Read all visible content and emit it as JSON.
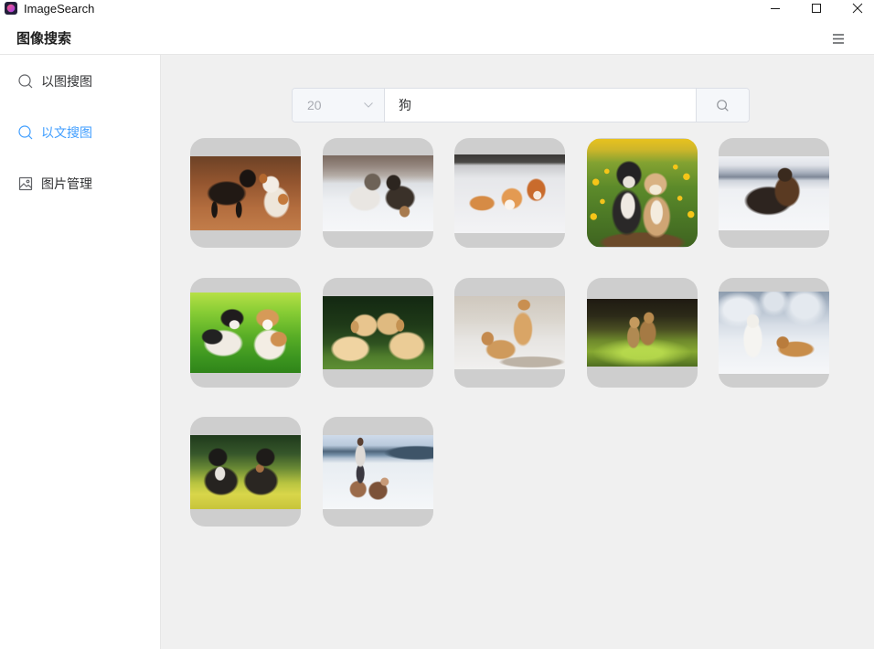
{
  "window": {
    "app_name": "ImageSearch",
    "app_icon": "app-logo-icon",
    "controls": {
      "minimize": "minimize-icon",
      "maximize": "maximize-icon",
      "close": "close-icon"
    }
  },
  "header": {
    "title": "图像搜索",
    "menu_icon": "menu-icon"
  },
  "sidebar": {
    "items": [
      {
        "label": "以图搜图",
        "icon": "search-icon",
        "active": false
      },
      {
        "label": "以文搜图",
        "icon": "search-icon",
        "active": true
      },
      {
        "label": "图片管理",
        "icon": "image-icon",
        "active": false
      }
    ]
  },
  "search": {
    "limit_value": "20",
    "limit_icon": "chevron-down-icon",
    "query": "狗",
    "button_icon": "search-icon"
  },
  "colors": {
    "accent": "#409eff",
    "text": "#303133",
    "muted_text": "#a8abb2",
    "content_background": "#f0f0f0",
    "card_background": "#cecece"
  }
}
